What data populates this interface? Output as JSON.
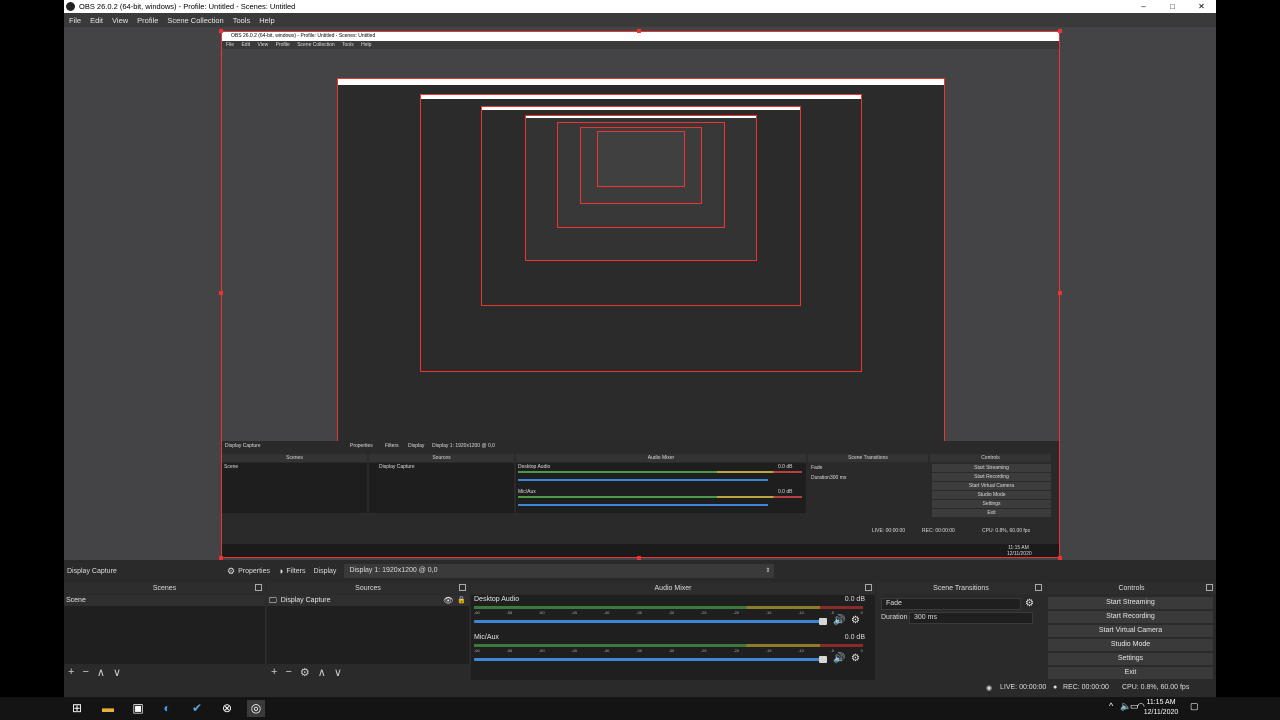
{
  "window": {
    "title": "OBS 26.0.2 (64-bit, windows) - Profile: Untitled - Scenes: Untitled",
    "controls": [
      "–",
      "□",
      "✕"
    ]
  },
  "menu": [
    "File",
    "Edit",
    "View",
    "Profile",
    "Scene Collection",
    "Tools",
    "Help"
  ],
  "nested": {
    "title": "OBS 26.0.2 (64-bit, windows) - Profile: Untitled - Scenes: Untitled",
    "menu": [
      "File",
      "Edit",
      "View",
      "Profile",
      "Scene Collection",
      "Tools",
      "Help"
    ],
    "source_label": "Display Capture",
    "properties": "Properties",
    "filters": "Filters",
    "display": "Display",
    "display_value": "Display 1: 1920x1200 @ 0,0",
    "scenes": "Scenes",
    "sources": "Sources",
    "mixer": "Audio Mixer",
    "transitions": "Scene Transitions",
    "controls": "Controls",
    "scene_item": "Scene",
    "source_item": "Display Capture",
    "desktop_audio": "Desktop Audio",
    "mic": "Mic/Aux",
    "db": "0.0 dB",
    "fade": "Fade",
    "duration": "Duration",
    "duration_value": "300 ms",
    "buttons": [
      "Start Streaming",
      "Start Recording",
      "Start Virtual Camera",
      "Studio Mode",
      "Settings",
      "Exit"
    ],
    "live": "LIVE: 00:00:00",
    "rec": "REC: 00:00:00",
    "cpu": "CPU: 0.8%, 60.00 fps",
    "time": "11:15 AM",
    "date": "12/11/2020"
  },
  "source_toolbar": {
    "current_source": "Display Capture",
    "properties": "Properties",
    "filters": "Filters",
    "display_label": "Display",
    "display_value": "Display 1: 1920x1200 @ 0,0"
  },
  "scenes": {
    "header": "Scenes",
    "items": [
      "Scene"
    ],
    "footer": [
      "+",
      "−",
      "∧",
      "∨"
    ]
  },
  "sources": {
    "header": "Sources",
    "items": [
      "Display Capture"
    ],
    "footer": [
      "+",
      "−",
      "⚙",
      "∧",
      "∨"
    ]
  },
  "mixer": {
    "header": "Audio Mixer",
    "tracks": [
      {
        "name": "Desktop Audio",
        "db": "0.0 dB"
      },
      {
        "name": "Mic/Aux",
        "db": "0.0 dB"
      }
    ],
    "ticks": [
      "-60",
      "-55",
      "-50",
      "-45",
      "-40",
      "-35",
      "-30",
      "-25",
      "-20",
      "-15",
      "-10",
      "-5",
      "0"
    ]
  },
  "transitions": {
    "header": "Scene Transitions",
    "selected": "Fade",
    "duration_label": "Duration",
    "duration_value": "300 ms"
  },
  "controls": {
    "header": "Controls",
    "buttons": [
      "Start Streaming",
      "Start Recording",
      "Start Virtual Camera",
      "Studio Mode",
      "Settings",
      "Exit"
    ]
  },
  "status": {
    "live": "LIVE: 00:00:00",
    "rec": "REC: 00:00:00",
    "cpu": "CPU: 0.8%, 60.00 fps"
  },
  "taskbar": {
    "time": "11:15 AM",
    "date": "12/11/2020"
  },
  "colors": {
    "accent_red": "#e33333",
    "volume_blue": "#3d86d6",
    "meter_green": "#3b7a3b",
    "meter_yellow": "#8d7d2a",
    "meter_red": "#8a2b2b"
  }
}
